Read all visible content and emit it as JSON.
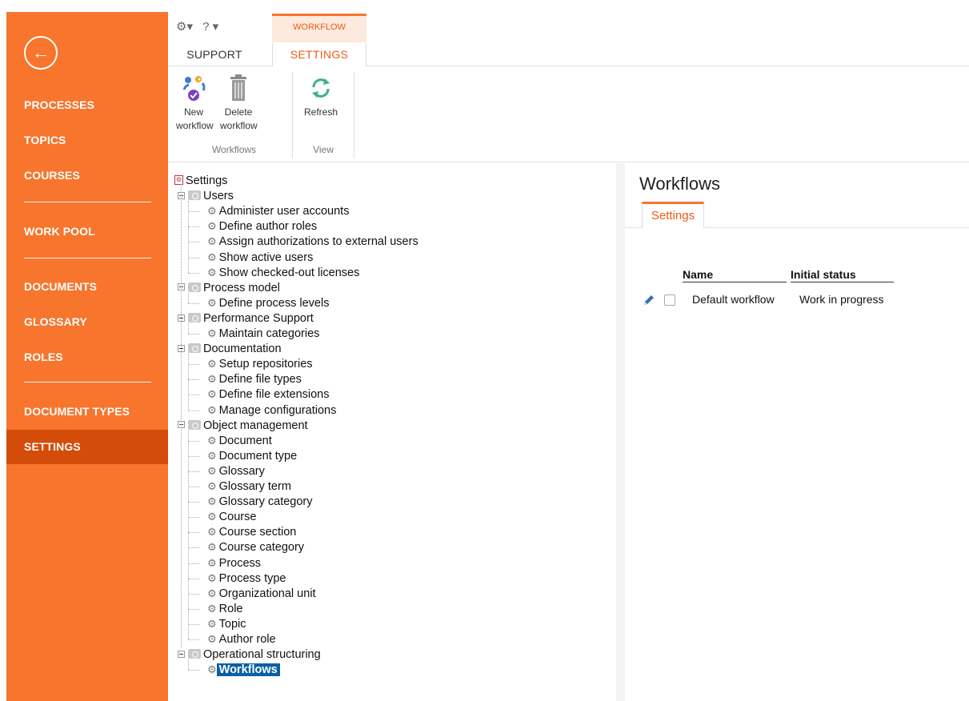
{
  "nav": {
    "back_icon": "arrow-left-icon",
    "items": [
      "PROCESSES",
      "TOPICS",
      "COURSES",
      "WORK POOL",
      "DOCUMENTS",
      "GLOSSARY",
      "ROLES",
      "DOCUMENT TYPES",
      "SETTINGS"
    ],
    "active": "SETTINGS",
    "color": "#f7752d",
    "active_color": "#d44c0a"
  },
  "ribbon": {
    "quick_access": {
      "gear": "⚙▾",
      "help": "? ▾"
    },
    "context_tab_header": "WORKFLOW",
    "tabs": [
      "SUPPORT",
      "SETTINGS"
    ],
    "active_tab": "SETTINGS",
    "buttons": {
      "new_workflow": {
        "line1": "New",
        "line2": "workflow"
      },
      "delete_workflow": {
        "line1": "Delete",
        "line2": "workflow"
      },
      "refresh": {
        "line1": "Refresh"
      }
    },
    "groups": {
      "workflows": "Workflows",
      "view": "View"
    }
  },
  "tree": {
    "root": "Settings",
    "nodes": [
      {
        "label": "Users",
        "children": [
          "Administer user accounts",
          "Define author roles",
          "Assign authorizations to external users",
          "Show active users",
          "Show checked-out licenses"
        ]
      },
      {
        "label": "Process model",
        "children": [
          "Define process levels"
        ]
      },
      {
        "label": "Performance Support",
        "children": [
          "Maintain categories"
        ]
      },
      {
        "label": "Documentation",
        "children": [
          "Setup repositories",
          "Define file types",
          "Define file extensions",
          "Manage configurations"
        ]
      },
      {
        "label": "Object management",
        "children": [
          "Document",
          "Document type",
          "Glossary",
          "Glossary term",
          "Glossary category",
          "Course",
          "Course section",
          "Course category",
          "Process",
          "Process type",
          "Organizational unit",
          "Role",
          "Topic",
          "Author role"
        ]
      },
      {
        "label": "Operational structuring",
        "children": [
          "Workflows"
        ]
      }
    ],
    "selected": "Workflows"
  },
  "panel": {
    "title": "Workflows",
    "tab": "Settings",
    "columns": [
      "Name",
      "Initial status"
    ],
    "rows": [
      {
        "name": "Default workflow",
        "initial_status": "Work in progress"
      }
    ]
  }
}
